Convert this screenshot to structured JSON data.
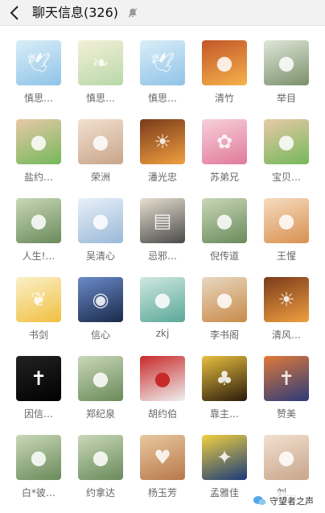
{
  "header": {
    "title": "聊天信息(326)"
  },
  "members": [
    {
      "name": "慎思…",
      "icon": "dove-icon"
    },
    {
      "name": "慎思…",
      "icon": "book-icon"
    },
    {
      "name": "慎思…",
      "icon": "dove-icon"
    },
    {
      "name": "清竹",
      "icon": "cyclist-icon"
    },
    {
      "name": "举目",
      "icon": "road-icon"
    },
    {
      "name": "盐约…",
      "icon": "child-icon"
    },
    {
      "name": "荣洲",
      "icon": "family-icon"
    },
    {
      "name": "潘光忠",
      "icon": "sunset-icon"
    },
    {
      "name": "苏弟兄",
      "icon": "flower-icon"
    },
    {
      "name": "宝贝…",
      "icon": "child-icon"
    },
    {
      "name": "人生!…",
      "icon": "person-icon"
    },
    {
      "name": "吴清心",
      "icon": "sky-icon"
    },
    {
      "name": "忌邪…",
      "icon": "bible-icon"
    },
    {
      "name": "倪传道",
      "icon": "person-icon"
    },
    {
      "name": "王惺",
      "icon": "jesus-text-icon"
    },
    {
      "name": "书剑",
      "icon": "leaf-icon"
    },
    {
      "name": "信心",
      "icon": "earth-icon"
    },
    {
      "name": "zkj",
      "icon": "hand-icon"
    },
    {
      "name": "李书阁",
      "icon": "reading-icon"
    },
    {
      "name": "清风…",
      "icon": "sunset-icon"
    },
    {
      "name": "因信…",
      "icon": "cross-icon"
    },
    {
      "name": "郑纪泉",
      "icon": "person-icon"
    },
    {
      "name": "胡约伯",
      "icon": "figure-icon"
    },
    {
      "name": "靠主…",
      "icon": "tree-icon"
    },
    {
      "name": "赞美",
      "icon": "worship-icon"
    },
    {
      "name": "白*彼…",
      "icon": "person-icon"
    },
    {
      "name": "约拿达",
      "icon": "person-icon"
    },
    {
      "name": "杨玉芳",
      "icon": "heart-icon"
    },
    {
      "name": "孟雅佳",
      "icon": "starry-night-icon"
    },
    {
      "name": "刘…",
      "icon": "family-icon"
    }
  ],
  "watermark": {
    "text": "守望者之声"
  }
}
